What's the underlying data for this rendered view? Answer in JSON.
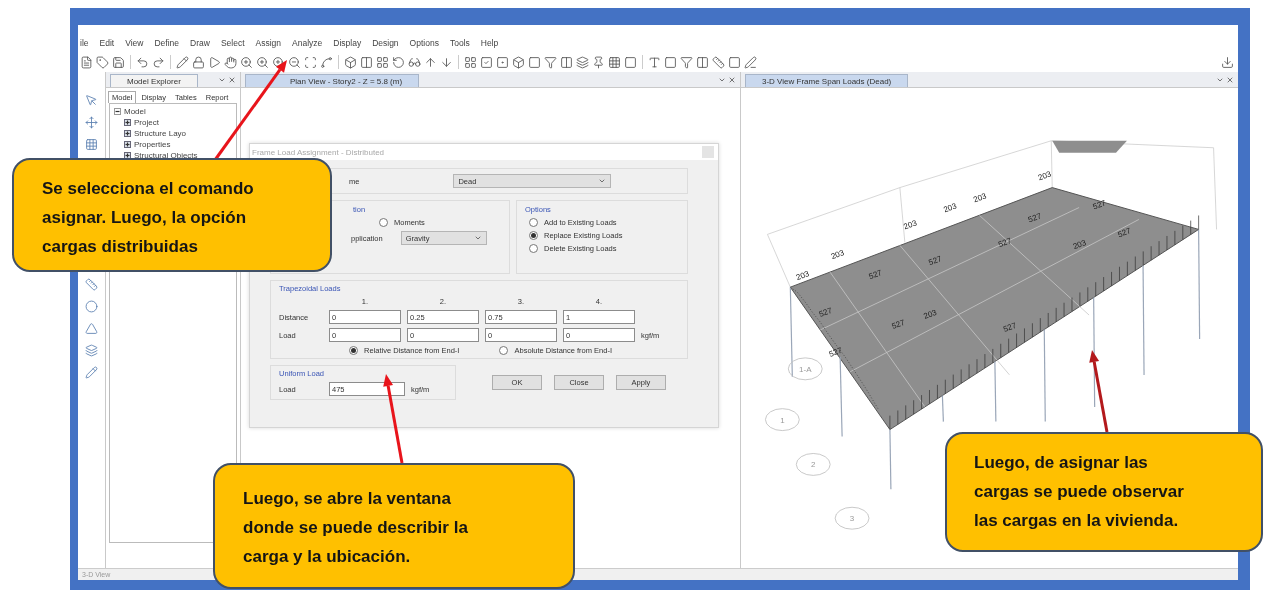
{
  "menu_bar": [
    "ile",
    "Edit",
    "View",
    "Define",
    "Draw",
    "Select",
    "Assign",
    "Analyze",
    "Display",
    "Design",
    "Options",
    "Tools",
    "Help"
  ],
  "explorer": {
    "title": "Model Explorer",
    "tabs": [
      {
        "label": "Model",
        "selected": true
      },
      {
        "label": "Display",
        "selected": false
      },
      {
        "label": "Tables",
        "selected": false
      },
      {
        "label": "Report",
        "selected": false
      }
    ],
    "tree": [
      {
        "label": "Model",
        "expanded": true,
        "children": [
          {
            "label": "Project",
            "expanded": false
          },
          {
            "label": "Structure Layo",
            "expanded": false
          },
          {
            "label": "Properties",
            "expanded": false
          },
          {
            "label": "Structural Objects",
            "expanded": false
          }
        ]
      }
    ]
  },
  "plan_view": {
    "tab": "Plan View - Story2 - Z = 5.8 (m)"
  },
  "dialog": {
    "title": "Frame Load Assignment - Distributed",
    "pattern_label": "me",
    "pattern_value": "Dead",
    "direction_legend": "tion",
    "moments": {
      "label": "Moments",
      "selected": false
    },
    "direction_label": "pplication",
    "direction_value": "Gravity",
    "options": {
      "legend": "Options",
      "items": [
        {
          "label": "Add to Existing Loads",
          "selected": false
        },
        {
          "label": "Replace Existing Loads",
          "selected": true
        },
        {
          "label": "Delete Existing Loads",
          "selected": false
        }
      ]
    },
    "trapezoidal": {
      "legend": "Trapezoidal Loads",
      "columns": [
        "1.",
        "2.",
        "3.",
        "4."
      ],
      "distance_label": "Distance",
      "distances": [
        "0",
        "0.25",
        "0.75",
        "1"
      ],
      "load_label": "Load",
      "loads": [
        "0",
        "0",
        "0",
        "0"
      ],
      "unit": "kgf/m",
      "modes": [
        {
          "label": "Relative Distance from End-I",
          "selected": true
        },
        {
          "label": "Absolute Distance from End-I",
          "selected": false
        }
      ]
    },
    "uniform": {
      "legend": "Uniform Load",
      "label": "Load",
      "value": "475",
      "unit": "kgf/m"
    },
    "buttons": [
      "OK",
      "Close",
      "Apply"
    ]
  },
  "view_3d": {
    "tab": "3-D View  Frame Span Loads (Dead)",
    "load_labels": [
      "203",
      "203",
      "203",
      "203",
      "203",
      "203",
      "527",
      "527",
      "527",
      "527",
      "527",
      "527",
      "527",
      "527",
      "527",
      "527",
      "203",
      "203"
    ],
    "grid_bubbles": [
      "1-A",
      "1",
      "2",
      "3"
    ]
  },
  "status_bar": {
    "view": "3-D View"
  },
  "callouts": [
    {
      "text": "Se selecciona el comando\nasignar. Luego, la opción\ncargas distribuidas"
    },
    {
      "text": "Luego, se abre la ventana\ndonde se puede describir la\ncarga y la ubicación."
    },
    {
      "text": "Luego, de asignar las\ncargas se puede observar\nlas cargas en  la vivienda."
    }
  ]
}
